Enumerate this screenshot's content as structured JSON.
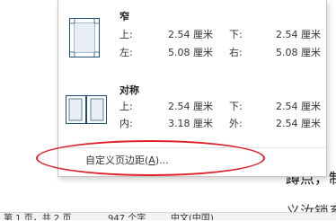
{
  "margins_menu": {
    "options": [
      {
        "title": "窄",
        "row1": {
          "l1": "上:",
          "v1": "2.54 厘米",
          "l2": "下:",
          "v2": "2.54 厘米"
        },
        "row2": {
          "l1": "左:",
          "v1": "5.08 厘米",
          "l2": "右:",
          "v2": "5.08 厘米"
        }
      },
      {
        "title": "对称",
        "row1": {
          "l1": "上:",
          "v1": "2.54 厘米",
          "l2": "下:",
          "v2": "2.54 厘米"
        },
        "row2": {
          "l1": "内:",
          "v1": "3.18 厘米",
          "l2": "外:",
          "v2": "2.54 厘米"
        }
      }
    ],
    "custom_label_pre": "自定义页边距(",
    "custom_label_key": "A",
    "custom_label_post": ")..."
  },
  "document": {
    "visible_text": "蹲点，制",
    "visible_text2": "义汝锁系"
  },
  "status_bar": {
    "page": "第 1 页，共 2 页",
    "words": "947 个字",
    "lang": "中文(中国)"
  },
  "colors": {
    "annotation": "#e0202a",
    "thumb_outline": "#1f4e79"
  },
  "icons": {
    "narrow_thumb": "page-margin-narrow-icon",
    "mirrored_thumb": "page-margin-mirrored-icon"
  }
}
